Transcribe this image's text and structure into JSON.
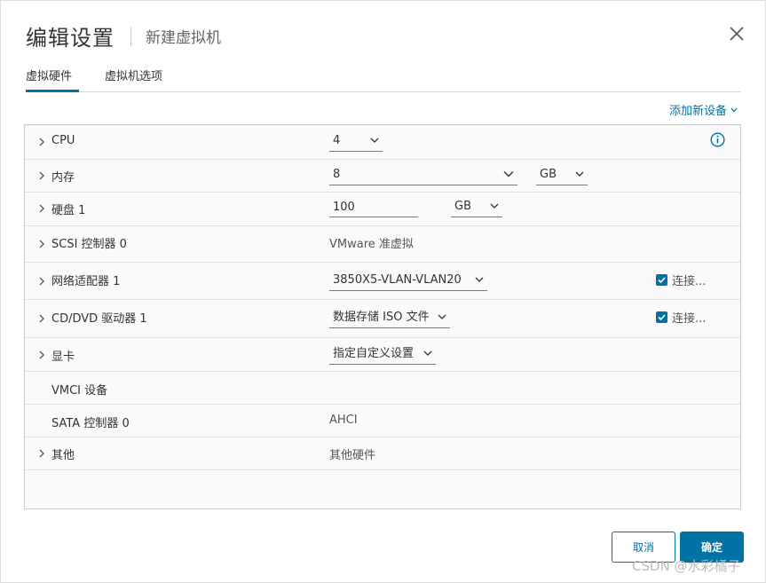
{
  "header": {
    "title": "编辑设置",
    "subtitle": "新建虚拟机"
  },
  "tabs": [
    {
      "label": "虚拟硬件",
      "active": true
    },
    {
      "label": "虚拟机选项",
      "active": false
    }
  ],
  "add_device": {
    "label": "添加新设备"
  },
  "rows": [
    {
      "label": "CPU",
      "select": "4"
    },
    {
      "label": "内存",
      "value": "8",
      "unit": "GB"
    },
    {
      "label": "硬盘 1",
      "value": "100",
      "unit": "GB"
    },
    {
      "label": "SCSI 控制器 0",
      "value": "VMware 准虚拟"
    },
    {
      "label": "网络适配器 1",
      "select": "3850X5-VLAN-VLAN20",
      "checkbox_label": "连接...",
      "checked": true
    },
    {
      "label": "CD/DVD 驱动器 1",
      "select": "数据存储 ISO 文件",
      "checkbox_label": "连接...",
      "checked": true
    },
    {
      "label": "显卡",
      "select": "指定自定义设置"
    },
    {
      "label": "VMCI 设备"
    },
    {
      "label": "SATA 控制器 0",
      "value": "AHCI"
    },
    {
      "label": "其他",
      "value": "其他硬件"
    }
  ],
  "buttons": {
    "cancel": "取消",
    "ok": "确定"
  },
  "watermark": "CSDN @水彩橘子",
  "colors": {
    "accent": "#0072a3",
    "border": "#cccccc",
    "grid_bg": "#fafafa"
  }
}
